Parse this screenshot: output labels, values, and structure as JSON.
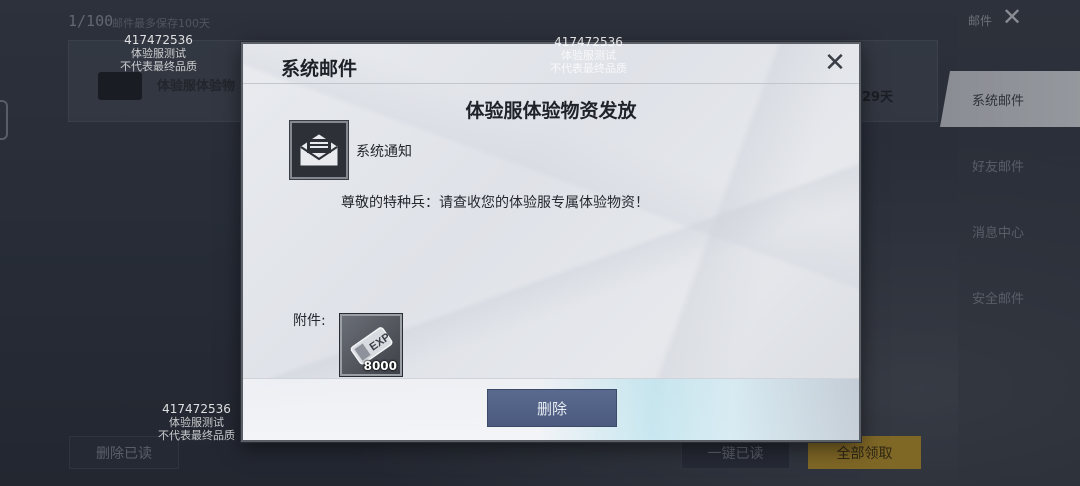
{
  "background": {
    "mail_count": "1/100",
    "mail_limit_hint": "邮件最多保存100天",
    "list_item_title": "体验服体验物",
    "list_item_days": "29天",
    "bottom_buttons": {
      "delete_read": "删除已读",
      "one_key_read": "一键已读",
      "claim_all": "全部领取"
    }
  },
  "right_panel": {
    "title": "邮件",
    "tabs": [
      {
        "label": "系统邮件",
        "active": true
      },
      {
        "label": "好友邮件",
        "active": false
      },
      {
        "label": "消息中心",
        "active": false
      },
      {
        "label": "安全邮件",
        "active": false
      }
    ]
  },
  "watermark": {
    "id": "417472536",
    "line1": "体验服测试",
    "line2": "不代表最终品质"
  },
  "dialog": {
    "title": "系统邮件",
    "subject": "体验服体验物资发放",
    "sender": "系统通知",
    "body": "尊敬的特种兵：请查收您的体验服专属体验物资！",
    "attachment_label": "附件:",
    "attachment": {
      "icon": "exp-card-icon",
      "quantity": "8000"
    },
    "delete_button": "删除"
  },
  "colors": {
    "claim_button": "#b8922a",
    "delete_button": "#4b5a7e",
    "active_tab": "#d2d5da"
  }
}
